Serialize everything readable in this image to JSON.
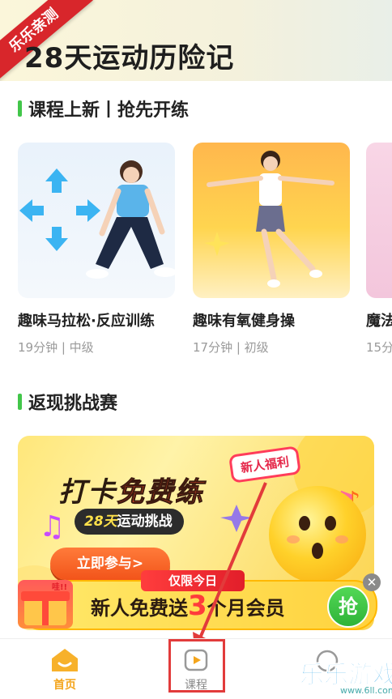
{
  "banner": {
    "ribbon": "乐乐亲测",
    "title": "28天运动历险记"
  },
  "new_courses": {
    "section_title": "课程上新丨抢先开练",
    "items": [
      {
        "name": "趣味马拉松·反应训练",
        "meta": "19分钟 | 中级"
      },
      {
        "name": "趣味有氧健身操",
        "meta": "17分钟 | 初级"
      },
      {
        "name": "魔法",
        "meta": "15分"
      }
    ]
  },
  "challenge": {
    "section_title": "返现挑战赛",
    "promo": {
      "headline_a": "打卡",
      "headline_b": "免费练",
      "sub_accent": "28天",
      "sub_text": "运动挑战",
      "tag": "新人福利",
      "join_button": "立即参与>"
    },
    "offer": {
      "pill": "仅限今日",
      "text_a": "新人免费送",
      "text_num": "3",
      "text_b": "个月会员",
      "grab_button": "抢",
      "gift_tag": "哇!!",
      "close": "✕"
    }
  },
  "tabbar": {
    "home": "首页",
    "course": "课程"
  },
  "watermark": {
    "text": "乐乐游戏",
    "url": "www.6ll.com"
  },
  "colors": {
    "accent_green": "#42c64a",
    "tab_active": "#f4a51c",
    "ribbon_red": "#d8262b",
    "highlight_red": "#e23b3b"
  }
}
